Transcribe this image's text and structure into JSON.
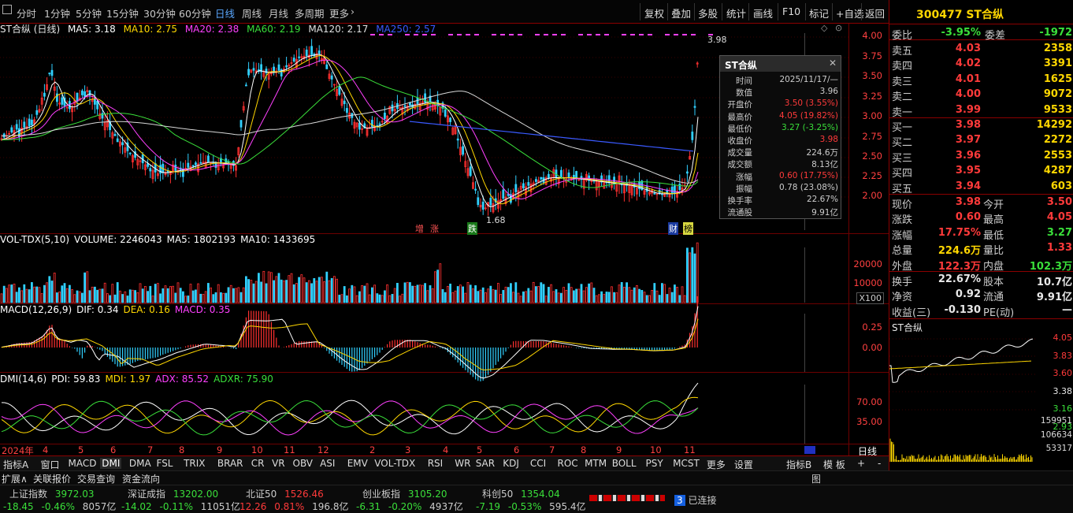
{
  "toolbar": {
    "periods": [
      "分时",
      "1分钟",
      "5分钟",
      "15分钟",
      "30分钟",
      "60分钟",
      "日线",
      "周线",
      "月线",
      "多周期",
      "更多"
    ],
    "selected": "日线",
    "right_buttons": [
      "复权",
      "叠加",
      "多股",
      "统计",
      "画线",
      "F10",
      "标记",
      "+自选",
      "返回"
    ]
  },
  "main_chart": {
    "title": "ST合纵 (日线)",
    "ma": [
      {
        "label": "MA5: 3.18",
        "color": "#ffffff"
      },
      {
        "label": "MA10: 2.75",
        "color": "#ffd700"
      },
      {
        "label": "MA20: 2.38",
        "color": "#ff40ff"
      },
      {
        "label": "MA60: 2.19",
        "color": "#3adf3a"
      },
      {
        "label": "MA120: 2.17",
        "color": "#e0e0e0"
      },
      {
        "label": "MA250: 2.57",
        "color": "#3a5aff"
      }
    ],
    "y_ticks": [
      "4.00",
      "3.75",
      "3.50",
      "3.25",
      "3.00",
      "2.75",
      "2.50",
      "2.25",
      "2.00"
    ],
    "high_label": "3.98",
    "low_label": "1.68",
    "markers": [
      "增",
      "涨",
      "跌",
      "财",
      "榜"
    ]
  },
  "popup": {
    "title": "ST合纵",
    "rows": [
      {
        "k": "时间",
        "v": "2025/11/17/—",
        "c": "#cccccc"
      },
      {
        "k": "数值",
        "v": "3.96",
        "c": "#cccccc"
      },
      {
        "k": "开盘价",
        "v": "3.50 (3.55%)",
        "c": "#ff3a3a"
      },
      {
        "k": "最高价",
        "v": "4.05 (19.82%)",
        "c": "#ff3a3a"
      },
      {
        "k": "最低价",
        "v": "3.27 (-3.25%)",
        "c": "#3adf3a"
      },
      {
        "k": "收盘价",
        "v": "3.98",
        "c": "#ff3a3a"
      },
      {
        "k": "成交量",
        "v": "224.6万",
        "c": "#cccccc"
      },
      {
        "k": "成交额",
        "v": "8.13亿",
        "c": "#cccccc"
      },
      {
        "k": "涨幅",
        "v": "0.60 (17.75%)",
        "c": "#ff3a3a"
      },
      {
        "k": "振幅",
        "v": "0.78 (23.08%)",
        "c": "#cccccc"
      },
      {
        "k": "换手率",
        "v": "22.67%",
        "c": "#cccccc"
      },
      {
        "k": "流通股",
        "v": "9.91亿",
        "c": "#cccccc"
      }
    ]
  },
  "vol": {
    "title": "VOL-TDX(5,10)",
    "items": [
      "VOLUME: 2246043",
      "MA5: 1802193",
      "MA10: 1433695"
    ],
    "y_ticks": [
      "20000",
      "10000"
    ],
    "unit": "X100"
  },
  "macd": {
    "title": "MACD(12,26,9)",
    "items": [
      "DIF: 0.34",
      "DEA: 0.16",
      "MACD: 0.35"
    ],
    "y_ticks": [
      "0.25",
      "0.00"
    ]
  },
  "dmi": {
    "title": "DMI(14,6)",
    "items": [
      "PDI: 59.83",
      "MDI: 1.97",
      "ADX: 85.52",
      "ADXR: 75.90"
    ],
    "y_ticks": [
      "70.00",
      "35.00"
    ]
  },
  "x_axis": [
    "2024年",
    "4",
    "5",
    "6",
    "7",
    "8",
    "9",
    "10",
    "11",
    "12",
    "2",
    "3",
    "4",
    "5",
    "6",
    "7",
    "8",
    "9",
    "10",
    "11"
  ],
  "quote": {
    "code_name": "300477 ST合纵",
    "weibi": {
      "label": "委比",
      "value": "-3.95%",
      "label2": "委差",
      "value2": "-1972"
    },
    "sell": [
      {
        "l": "卖五",
        "p": "4.03",
        "v": "2358"
      },
      {
        "l": "卖四",
        "p": "4.02",
        "v": "3391"
      },
      {
        "l": "卖三",
        "p": "4.01",
        "v": "1625"
      },
      {
        "l": "卖二",
        "p": "4.00",
        "v": "9072"
      },
      {
        "l": "卖一",
        "p": "3.99",
        "v": "9533"
      }
    ],
    "buy": [
      {
        "l": "买一",
        "p": "3.98",
        "v": "14292"
      },
      {
        "l": "买二",
        "p": "3.97",
        "v": "2272"
      },
      {
        "l": "买三",
        "p": "3.96",
        "v": "2553"
      },
      {
        "l": "买四",
        "p": "3.95",
        "v": "4287"
      },
      {
        "l": "买五",
        "p": "3.94",
        "v": "603"
      }
    ],
    "stats": [
      {
        "a": "现价",
        "b": "3.98",
        "bc": "red",
        "c": "今开",
        "d": "3.50",
        "dc": "red"
      },
      {
        "a": "涨跌",
        "b": "0.60",
        "bc": "red",
        "c": "最高",
        "d": "4.05",
        "dc": "red"
      },
      {
        "a": "涨幅",
        "b": "17.75%",
        "bc": "red",
        "c": "最低",
        "d": "3.27",
        "dc": "grn"
      },
      {
        "a": "总量",
        "b": "224.6万",
        "bc": "yel",
        "c": "量比",
        "d": "1.33",
        "dc": "red"
      },
      {
        "a": "外盘",
        "b": "122.3万",
        "bc": "red",
        "c": "内盘",
        "d": "102.3万",
        "dc": "grn"
      }
    ],
    "stats2": [
      {
        "a": "换手",
        "b": "22.67%",
        "bc": "wht",
        "c": "股本",
        "d": "10.7亿",
        "dc": "wht"
      },
      {
        "a": "净资",
        "b": "0.92",
        "bc": "wht",
        "c": "流通",
        "d": "9.91亿",
        "dc": "wht"
      },
      {
        "a": "收益(三)",
        "b": "-0.130",
        "bc": "wht",
        "c": "PE(动)",
        "d": "—",
        "dc": "wht"
      }
    ],
    "mini_title": "ST合纵",
    "mini_ticks": [
      "4.05",
      "3.83",
      "3.60",
      "3.38",
      "3.16",
      "2.93"
    ],
    "mini_vol_ticks": [
      "159951",
      "106634",
      "53317"
    ]
  },
  "tabs": {
    "items": [
      "指标A",
      "窗口",
      "MACD",
      "DMI",
      "DMA",
      "FSL",
      "TRIX",
      "BRAR",
      "CR",
      "VR",
      "OBV",
      "ASI",
      "EMV",
      "VOL-TDX",
      "RSI",
      "WR",
      "SAR",
      "KDJ",
      "CCI",
      "ROC",
      "MTM",
      "BOLL",
      "PSY",
      "MCST",
      "更多",
      "设置"
    ],
    "selected": "DMI",
    "right": [
      "指标B",
      "模 板",
      "+",
      "-"
    ],
    "period_label": "日线"
  },
  "links": [
    "扩展∧",
    "关联报价",
    "交易查询",
    "资金流向"
  ],
  "status": {
    "indices": [
      {
        "name": "上证指数",
        "value": "3972.03",
        "chg": "-18.45",
        "pct": "-0.46%",
        "amt": "8057亿"
      },
      {
        "name": "深证成指",
        "value": "13202.00",
        "chg": "-14.02",
        "pct": "-0.11%",
        "amt": "11051亿"
      },
      {
        "name": "北证50",
        "value": "1526.46",
        "chg": "12.26",
        "pct": "0.81%",
        "amt": "196.8亿"
      },
      {
        "name": "创业板指",
        "value": "3105.20",
        "chg": "-6.31",
        "pct": "-0.20%",
        "amt": "4937亿"
      },
      {
        "name": "科创50",
        "value": "1354.04",
        "chg": "-7.19",
        "pct": "-0.53%",
        "amt": "595.4亿"
      }
    ],
    "conn_count": "3",
    "conn_label": "已连接"
  }
}
